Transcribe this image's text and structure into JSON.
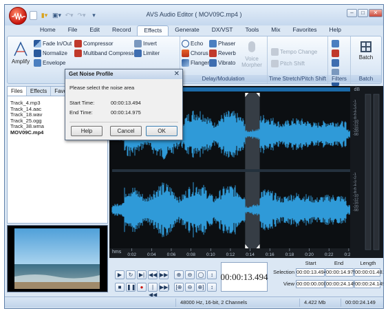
{
  "window": {
    "title": "AVS Audio Editor ( MOV09C.mp4 )"
  },
  "menu": [
    "Home",
    "File",
    "Edit",
    "Record",
    "Effects",
    "Generate",
    "DX/VST",
    "Tools",
    "Mix",
    "Favorites",
    "Help"
  ],
  "ribbon": {
    "amplify": "Amplify",
    "col1": [
      "Fade In/Out",
      "Normalize",
      "Envelope"
    ],
    "col2": [
      "Compressor",
      "Multiband Compressor"
    ],
    "col3": [
      "Invert",
      "Limiter"
    ],
    "col4": [
      "Echo",
      "Chorus",
      "Flanger"
    ],
    "col5": [
      "Phaser",
      "Reverb",
      "Vibrato"
    ],
    "voice_morpher": "Voice Morpher",
    "tempo_change": "Tempo Change",
    "pitch_shift": "Pitch Shift",
    "batch": "Batch",
    "groups": {
      "delay": "Delay/Modulation",
      "time": "Time Stretch/Pitch Shift",
      "filters": "Filters",
      "batch": "Batch"
    }
  },
  "left_panel": {
    "tabs": [
      "Files",
      "Effects",
      "Favori"
    ],
    "files": [
      "Track_4.mp3",
      "Track_14.aac",
      "Track_18.wav",
      "Track_25.ogg",
      "Track_38.wma",
      "MOV09C.mp4"
    ]
  },
  "waveform": {
    "timeline_labels": [
      "hms",
      "0:02",
      "0:04",
      "0:06",
      "0:08",
      "0:10",
      "0:12",
      "0:14",
      "0:16",
      "0:18",
      "0:20",
      "0:22",
      "0:24"
    ],
    "db_label": "dB",
    "db_scale": [
      "-1",
      "-2",
      "-3",
      "-4",
      "-6",
      "-8",
      "-10",
      "-12",
      "-16",
      "-20",
      "-90"
    ]
  },
  "controls": {
    "current_time": "00:00:13.494",
    "headers": {
      "start": "Start",
      "end": "End",
      "length": "Length"
    },
    "selection": {
      "label": "Selection",
      "start": "00:00:13.494",
      "end": "00:00:14.975",
      "length": "00:00:01.481"
    },
    "view": {
      "label": "View",
      "start": "00:00:00.000",
      "end": "00:00:24.149",
      "length": "00:00:24.149"
    }
  },
  "status": {
    "format": "48000 Hz, 16-bit, 2 Channels",
    "size": "4.422 Mb",
    "duration": "00:00:24.149"
  },
  "dialog": {
    "title": "Get Noise Profile",
    "prompt": "Please select the noise area",
    "start_label": "Start Time:",
    "start_value": "00:00:13.494",
    "end_label": "End Time:",
    "end_value": "00:00:14.975",
    "help": "Help",
    "cancel": "Cancel",
    "ok": "OK"
  },
  "colors": {
    "wave": "#2f9ad8",
    "background": "#0c0f12",
    "selection": "#5a6470"
  }
}
